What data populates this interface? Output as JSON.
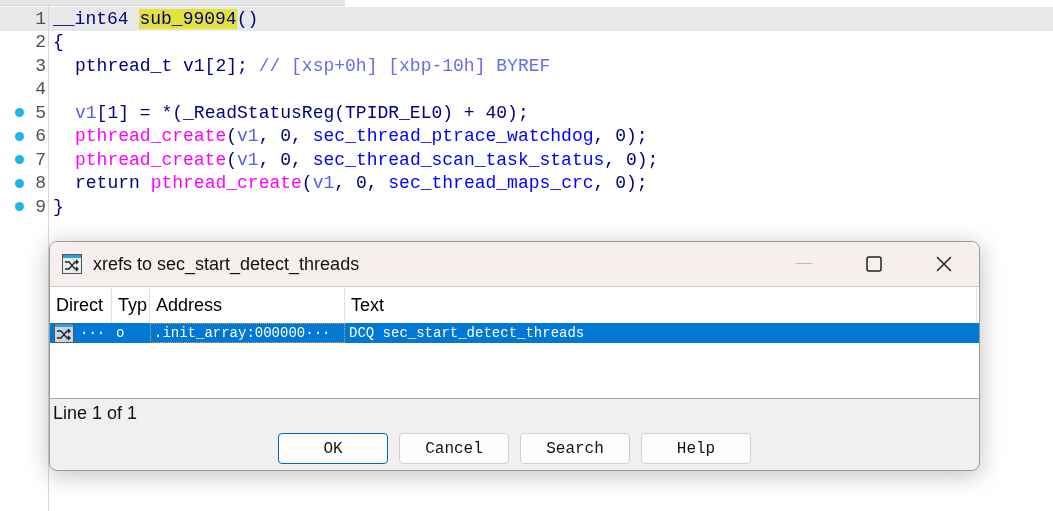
{
  "editor": {
    "lines": [
      {
        "number": "1",
        "current": true,
        "marked": false,
        "tokens": [
          {
            "kind": "plain",
            "text": "__int64 "
          },
          {
            "kind": "highlight",
            "text": "sub_99094"
          },
          {
            "kind": "plain",
            "text": "()"
          }
        ]
      },
      {
        "number": "2",
        "current": false,
        "marked": false,
        "tokens": [
          {
            "kind": "plain",
            "text": "{"
          }
        ]
      },
      {
        "number": "3",
        "current": false,
        "marked": false,
        "indent": true,
        "tokens": [
          {
            "kind": "plain",
            "text": "pthread_t v1[2]; "
          },
          {
            "kind": "comment",
            "text": "// [xsp+0h] [xbp-10h] BYREF"
          }
        ]
      },
      {
        "number": "4",
        "current": false,
        "marked": false
      },
      {
        "number": "5",
        "current": false,
        "marked": true,
        "indent": true,
        "tokens": [
          {
            "kind": "var",
            "text": "v1"
          },
          {
            "kind": "plain",
            "text": "[1] = *(_ReadStatusReg(TPIDR_EL0) + 40);"
          }
        ]
      },
      {
        "number": "6",
        "current": false,
        "marked": true,
        "indent": true,
        "tokens": [
          {
            "kind": "call",
            "text": "pthread_create"
          },
          {
            "kind": "plain",
            "text": "("
          },
          {
            "kind": "var",
            "text": "v1"
          },
          {
            "kind": "plain",
            "text": ", 0, "
          },
          {
            "kind": "ref",
            "text": "sec_thread_ptrace_watchdog"
          },
          {
            "kind": "plain",
            "text": ", 0);"
          }
        ]
      },
      {
        "number": "7",
        "current": false,
        "marked": true,
        "indent": true,
        "tokens": [
          {
            "kind": "call",
            "text": "pthread_create"
          },
          {
            "kind": "plain",
            "text": "("
          },
          {
            "kind": "var",
            "text": "v1"
          },
          {
            "kind": "plain",
            "text": ", 0, "
          },
          {
            "kind": "ref",
            "text": "sec_thread_scan_task_status"
          },
          {
            "kind": "plain",
            "text": ", 0);"
          }
        ]
      },
      {
        "number": "8",
        "current": false,
        "marked": true,
        "indent": true,
        "tokens": [
          {
            "kind": "plain",
            "text": "return "
          },
          {
            "kind": "call",
            "text": "pthread_create"
          },
          {
            "kind": "plain",
            "text": "("
          },
          {
            "kind": "var",
            "text": "v1"
          },
          {
            "kind": "plain",
            "text": ", 0, "
          },
          {
            "kind": "ref",
            "text": "sec_thread_maps_crc"
          },
          {
            "kind": "plain",
            "text": ", 0);"
          }
        ]
      },
      {
        "number": "9",
        "current": false,
        "marked": true,
        "tokens": [
          {
            "kind": "plain",
            "text": "}"
          }
        ]
      }
    ]
  },
  "dialog": {
    "title": "xrefs to sec_start_detect_threads",
    "table": {
      "columns": [
        "Direct",
        "Typ",
        "Address",
        "Text"
      ],
      "rows": [
        {
          "selected": true,
          "cells": [
            "···",
            "o",
            ".init_array:000000···",
            "DCQ sec_start_detect_threads"
          ]
        }
      ]
    },
    "status": "Line 1 of 1",
    "buttons": [
      {
        "label": "OK",
        "default": true
      },
      {
        "label": "Cancel",
        "default": false
      },
      {
        "label": "Search",
        "default": false
      },
      {
        "label": "Help",
        "default": false
      }
    ]
  }
}
